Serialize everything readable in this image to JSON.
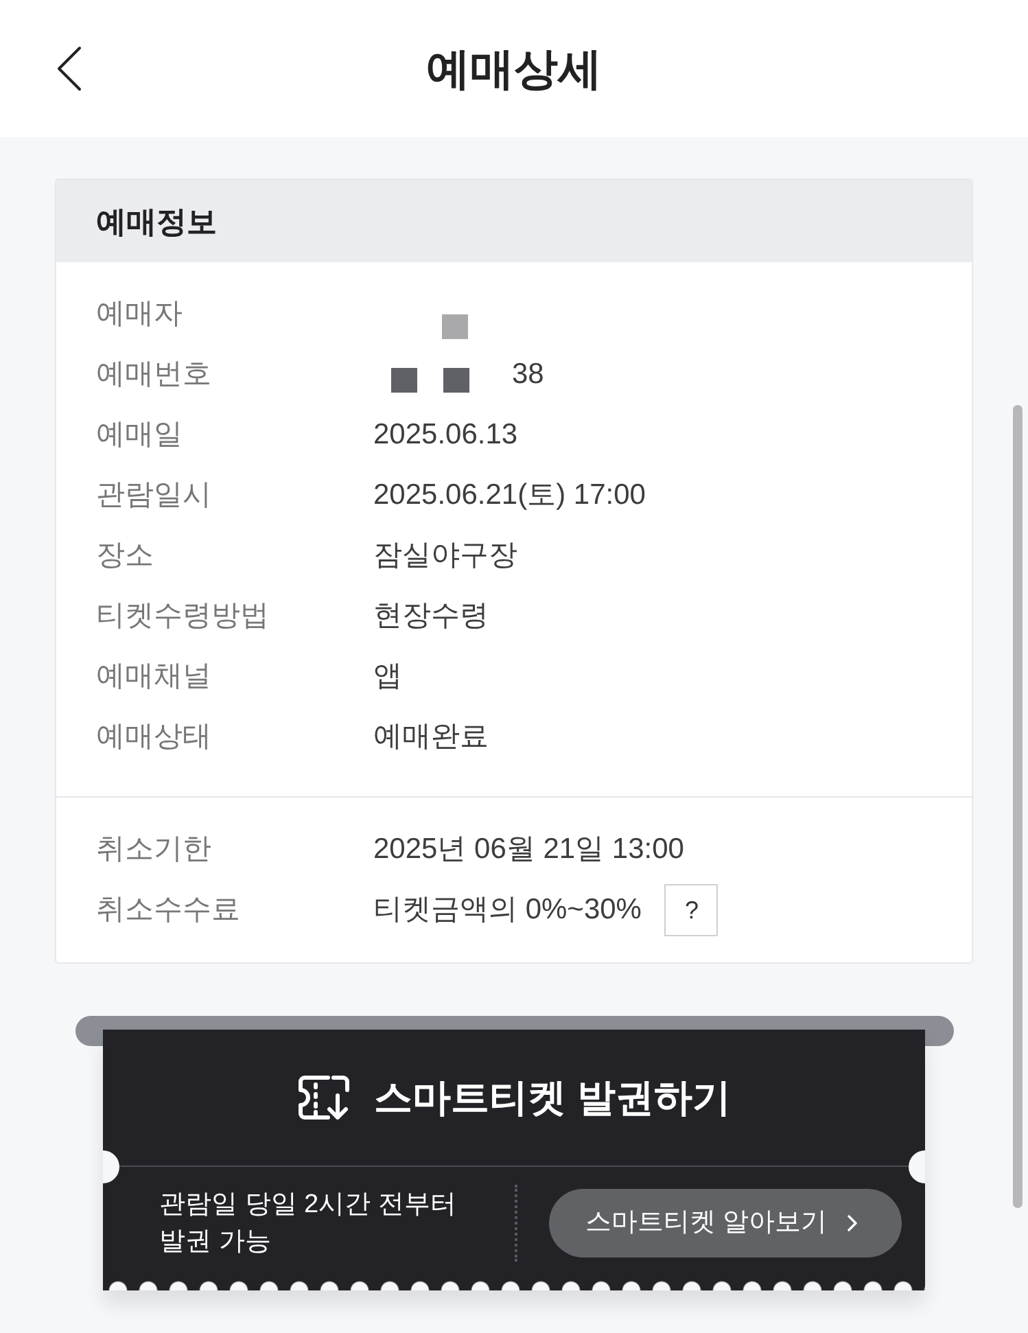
{
  "header": {
    "title": "예매상세"
  },
  "booking_info": {
    "title": "예매정보",
    "rows": [
      {
        "label": "예매자",
        "kind": "redacted"
      },
      {
        "label": "예매번호",
        "kind": "partly_redacted",
        "value": "38"
      },
      {
        "label": "예매일",
        "kind": "text",
        "value": "2025.06.13"
      },
      {
        "label": "관람일시",
        "kind": "text",
        "value": "2025.06.21(토) 17:00"
      },
      {
        "label": "장소",
        "kind": "text",
        "value": "잠실야구장"
      },
      {
        "label": "티켓수령방법",
        "kind": "text",
        "value": "현장수령"
      },
      {
        "label": "예매채널",
        "kind": "text",
        "value": "앱"
      },
      {
        "label": "예매상태",
        "kind": "text",
        "value": "예매완료"
      }
    ]
  },
  "cancellation": {
    "rows": [
      {
        "label": "취소기한",
        "value": "2025년 06월 21일 13:00"
      },
      {
        "label": "취소수수료",
        "value": "티켓금액의 0%~30%",
        "help_button": "?"
      }
    ]
  },
  "smart_ticket": {
    "title": "스마트티켓 발권하기",
    "note_lines": [
      "관람일 당일 2시간 전부터",
      "발권 가능"
    ],
    "button": "스마트티켓 알아보기"
  }
}
